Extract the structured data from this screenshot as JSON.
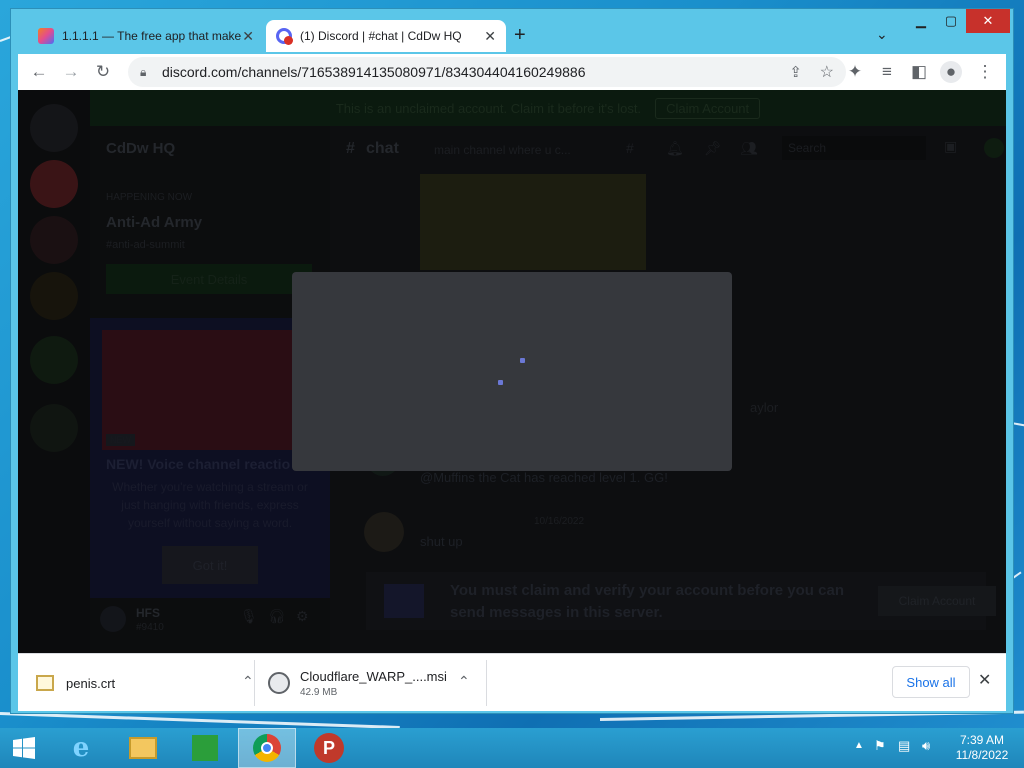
{
  "browser": {
    "tabs": [
      {
        "title": "1.1.1.1 — The free app that make"
      },
      {
        "title": "(1) Discord | #chat | CdDw HQ"
      }
    ],
    "new_tab_glyph": "+",
    "url": "discord.com/channels/716538914135080971/834304404160249886"
  },
  "discord": {
    "banner_text": "This is an unclaimed account. Claim it before it's lost.",
    "banner_button": "Claim Account",
    "server_name": "CdDw HQ",
    "event_status": "HAPPENING NOW",
    "event_title": "Anti-Ad Army",
    "event_subtitle": "#anti-ad-summit",
    "event_button": "Event Details",
    "promo_badge": "NEW",
    "promo_title": "NEW! Voice channel reactio",
    "promo_body": "Whether you're watching a stream or just hanging with friends, express yourself without saying a word.",
    "promo_button": "Got it!",
    "user_name": "HFS",
    "user_tag": "#9410",
    "channel_name": "chat",
    "channel_topic": "main channel where u c...",
    "search_placeholder": "Search",
    "message_fragment": "aylor",
    "level_message": "@Muffins the Cat has reached level 1. GG!",
    "message_date": "10/16/2022",
    "message_text": "shut up",
    "claim_notice": "You must claim and verify your account before you can send messages in this server.",
    "claim_button": "Claim Account"
  },
  "downloads": {
    "items": [
      {
        "name": "penis.crt",
        "size": ""
      },
      {
        "name": "Cloudflare_WARP_....msi",
        "size": "42.9 MB"
      }
    ],
    "show_all": "Show all"
  },
  "taskbar": {
    "time": "7:39 AM",
    "date": "11/8/2022",
    "apps": [
      "start",
      "internet-explorer",
      "file-explorer",
      "store",
      "chrome",
      "psiphon"
    ]
  },
  "colors": {
    "accent_blue": "#1a73e8",
    "discord_blurple": "#6b78d6",
    "modal_bg": "#36383d",
    "taskbar": "#1f86ba"
  }
}
